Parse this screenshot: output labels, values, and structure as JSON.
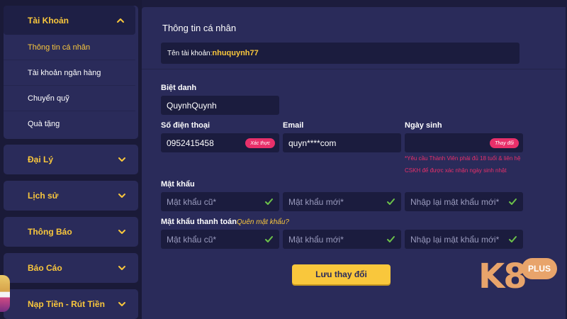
{
  "sidebar": {
    "account_group": {
      "title": "Tài Khoản",
      "items": [
        "Thông tin cá nhân",
        "Tài khoản ngân hàng",
        "Chuyển quỹ",
        "Quà tặng"
      ]
    },
    "menu": [
      "Đại Lý",
      "Lịch sử",
      "Thông Báo",
      "Báo Cáo",
      "Nạp Tiền - Rút Tiền"
    ]
  },
  "main": {
    "section_title": "Thông tin cá nhân",
    "account_label": "Tên tài khoản:",
    "account_value": "nhuquynh77",
    "nickname_label": "Biệt danh",
    "nickname_value": "QuynhQuynh",
    "phone_label": "Số điện thoại",
    "phone_value": "0952415458",
    "verify_label": "Xác thực",
    "email_label": "Email",
    "email_value": "quyn****com",
    "dob_label": "Ngày sinh",
    "dob_change_label": "Thay đổi",
    "dob_note": "*Yêu cầu Thành Viên phải đủ 18 tuổi & liên hệ CSKH để được xác nhận ngày sinh nhật",
    "password_label": "Mật khẩu",
    "payment_password_label": "Mật khẩu thanh toán",
    "forgot_password": "Quên mật khẩu?",
    "old_password_placeholder": "Mật khẩu cũ*",
    "new_password_placeholder": "Mật khẩu mới*",
    "confirm_password_placeholder": "Nhập lại mật khẩu mới*",
    "save_button": "Lưu thay đổi"
  },
  "logo": {
    "main": "K8",
    "badge": "PLUS"
  },
  "colors": {
    "background": "#1c1c3d",
    "panel": "#2a2b5a",
    "input": "#1b1c3e",
    "accent": "#f9c73c",
    "pink": "#e8306a",
    "check": "#6cc24a",
    "logo": "#e8a46b"
  }
}
